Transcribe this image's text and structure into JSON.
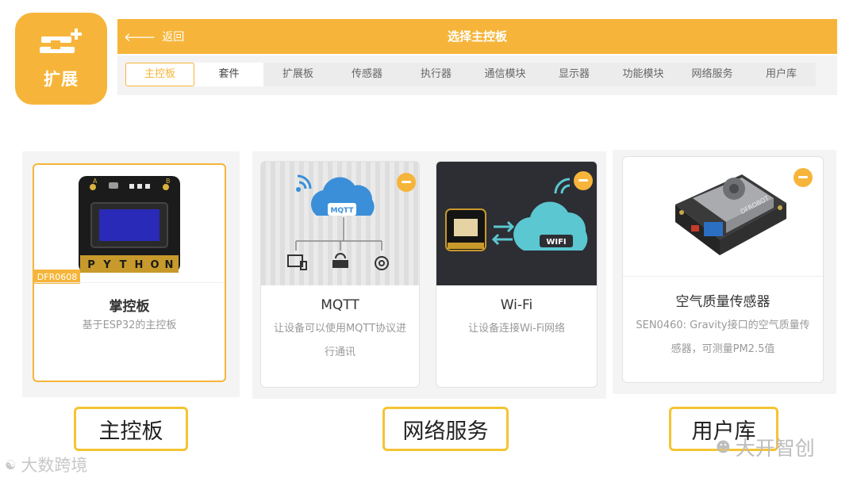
{
  "logo": {
    "label": "扩展",
    "icon": "extension-plus-icon"
  },
  "header": {
    "back_label": "返回",
    "back_icon": "arrow-left-icon",
    "title": "选择主控板"
  },
  "tabs": [
    {
      "label": "主控板",
      "active": true
    },
    {
      "label": "套件"
    },
    {
      "label": "扩展板"
    },
    {
      "label": "传感器"
    },
    {
      "label": "执行器"
    },
    {
      "label": "通信模块"
    },
    {
      "label": "显示器"
    },
    {
      "label": "功能模块"
    },
    {
      "label": "网络服务"
    },
    {
      "label": "用户库"
    }
  ],
  "cards": {
    "mainboard": {
      "title": "掌控板",
      "desc": "基于ESP32的主控板",
      "tag": "DFR0608",
      "pins": [
        "P",
        "Y",
        "T",
        "H",
        "O",
        "N"
      ],
      "corner_labels": [
        "A",
        "B"
      ]
    },
    "mqtt": {
      "title": "MQTT",
      "desc": "让设备可以使用MQTT协议进行通讯",
      "cloud_label": "MQTT"
    },
    "wifi": {
      "title": "Wi-Fi",
      "desc": "让设备连接Wi-Fi网络",
      "cloud_label": "WIFI"
    },
    "air": {
      "title": "空气质量传感器",
      "desc": "SEN0460: Gravity接口的空气质量传感器，可测量PM2.5值",
      "brand": "DFROBOT"
    }
  },
  "group_labels": {
    "mainboard": "主控板",
    "network": "网络服务",
    "userlib": "用户库"
  },
  "watermarks": {
    "left": "大数跨境",
    "right": "大开智创"
  },
  "colors": {
    "accent": "#f6b53a",
    "label_border": "#f5c433"
  }
}
